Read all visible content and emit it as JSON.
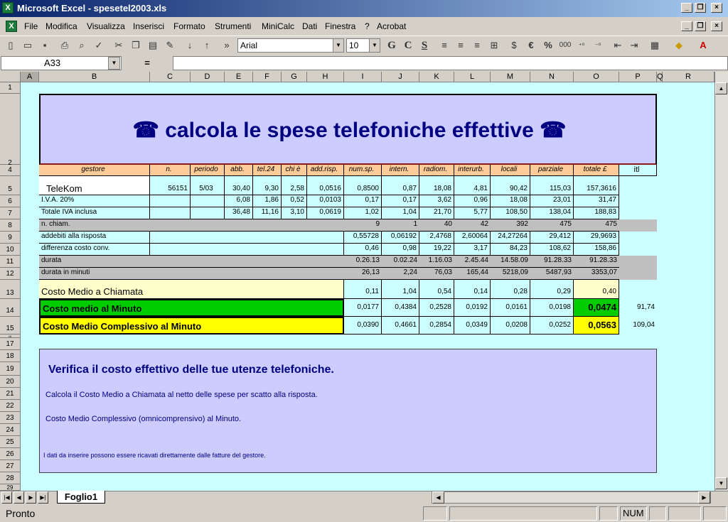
{
  "window": {
    "title": "Microsoft Excel - spesetel2003.xls",
    "icon": "excel-icon"
  },
  "menu": [
    "File",
    "Modifica",
    "Visualizza",
    "Inserisci",
    "Formato",
    "Strumenti",
    "MiniCalc",
    "Dati",
    "Finestra",
    "?",
    "Acrobat"
  ],
  "toolbar": {
    "font": "Arial",
    "size": "10",
    "bold": "G",
    "italic": "C",
    "underline": "S"
  },
  "formula": {
    "namebox": "A33",
    "fx": "="
  },
  "columns": [
    "A",
    "B",
    "C",
    "D",
    "E",
    "F",
    "G",
    "H",
    "I",
    "J",
    "K",
    "L",
    "M",
    "N",
    "O",
    "P",
    "Q",
    "R"
  ],
  "rows": [
    "1",
    "2",
    "",
    "4",
    "5",
    "6",
    "7",
    "8",
    "9",
    "10",
    "11",
    "12",
    "13",
    "14",
    "15",
    "16",
    "17",
    "18",
    "19",
    "20",
    "21",
    "22",
    "23",
    "24",
    "25",
    "26",
    "27",
    "28",
    "29"
  ],
  "sheet": {
    "title": "☎ calcola le spese telefoniche effettive ☎",
    "headers": [
      "gestore",
      "n.",
      "periodo",
      "abb.",
      "tel.24",
      "chi è",
      "add.risp.",
      "num.sp.",
      "intern.",
      "radiom.",
      "interurb.",
      "locali",
      "parziale",
      "totale £",
      "itl"
    ],
    "telekom": {
      "name": "TeleKom",
      "vals": [
        "56151",
        "5/03",
        "30,40",
        "9,30",
        "2,58",
        "0,0516",
        "0,8500",
        "0,87",
        "18,08",
        "4,81",
        "90,42",
        "115,03",
        "157,3616"
      ]
    },
    "iva": {
      "label": "I.V.A. 20%",
      "vals": [
        "6,08",
        "1,86",
        "0,52",
        "0,0103",
        "0,17",
        "0,17",
        "3,62",
        "0,96",
        "18,08",
        "23,01",
        "31,47"
      ]
    },
    "totiva": {
      "label": "Totale IVA inclusa",
      "vals": [
        "36,48",
        "11,16",
        "3,10",
        "0,0619",
        "1,02",
        "1,04",
        "21,70",
        "5,77",
        "108,50",
        "138,04",
        "188,83"
      ]
    },
    "nchiam": {
      "label": "n. chiam.",
      "vals": [
        "9",
        "1",
        "40",
        "42",
        "392",
        "475",
        "475"
      ]
    },
    "addebiti": {
      "label": "addebiti alla risposta",
      "vals": [
        "0,55728",
        "0,06192",
        "2,4768",
        "2,60064",
        "24,27264",
        "29,412",
        "29,9693"
      ]
    },
    "diff": {
      "label": "differenza costo conv.",
      "vals": [
        "0,46",
        "0,98",
        "19,22",
        "3,17",
        "84,23",
        "108,62",
        "158,86"
      ]
    },
    "durata": {
      "label": "durata",
      "vals": [
        "0.26.13",
        "0.02.24",
        "1.16.03",
        "2.45.44",
        "14.58.09",
        "91.28.33",
        "91.28.33"
      ]
    },
    "minuti": {
      "label": "durata in minuti",
      "vals": [
        "26,13",
        "2,24",
        "76,03",
        "165,44",
        "5218,09",
        "5487,93",
        "3353,07"
      ]
    },
    "costomedio": {
      "label": "Costo Medio a Chiamata",
      "vals": [
        "0,11",
        "1,04",
        "0,54",
        "0,14",
        "0,28",
        "0,29",
        "0,40"
      ]
    },
    "minuto": {
      "label": "Costo medio al Minuto",
      "vals": [
        "0,0177",
        "0,4384",
        "0,2528",
        "0,0192",
        "0,0161",
        "0,0198",
        "0,0474"
      ],
      "extra": "91,74"
    },
    "complessivo": {
      "label": "Costo Medio Complessivo al Minuto",
      "vals": [
        "0,0390",
        "0,4661",
        "0,2854",
        "0,0349",
        "0,0208",
        "0,0252",
        "0,0563"
      ],
      "extra": "109,04"
    },
    "info": {
      "heading": "Verifica il costo effettivo delle tue utenze telefoniche.",
      "line1": "Calcola il Costo Medio a Chiamata al netto delle spese per scatto alla risposta.",
      "line2": "Costo Medio Complessivo (omnicomprensivo) al Minuto.",
      "line3": "I dati da inserire possono essere ricavati direttamente dalle fatture del gestore."
    }
  },
  "tab": "Foglio1",
  "status": {
    "left": "Pronto",
    "num": "NUM"
  },
  "colors": {
    "green": "#00cc00",
    "yellow": "#ffff00",
    "lightyellow": "#ffffcc",
    "header": "#ffcc99",
    "lavender": "#ccccff",
    "cyan": "#ccffff"
  }
}
